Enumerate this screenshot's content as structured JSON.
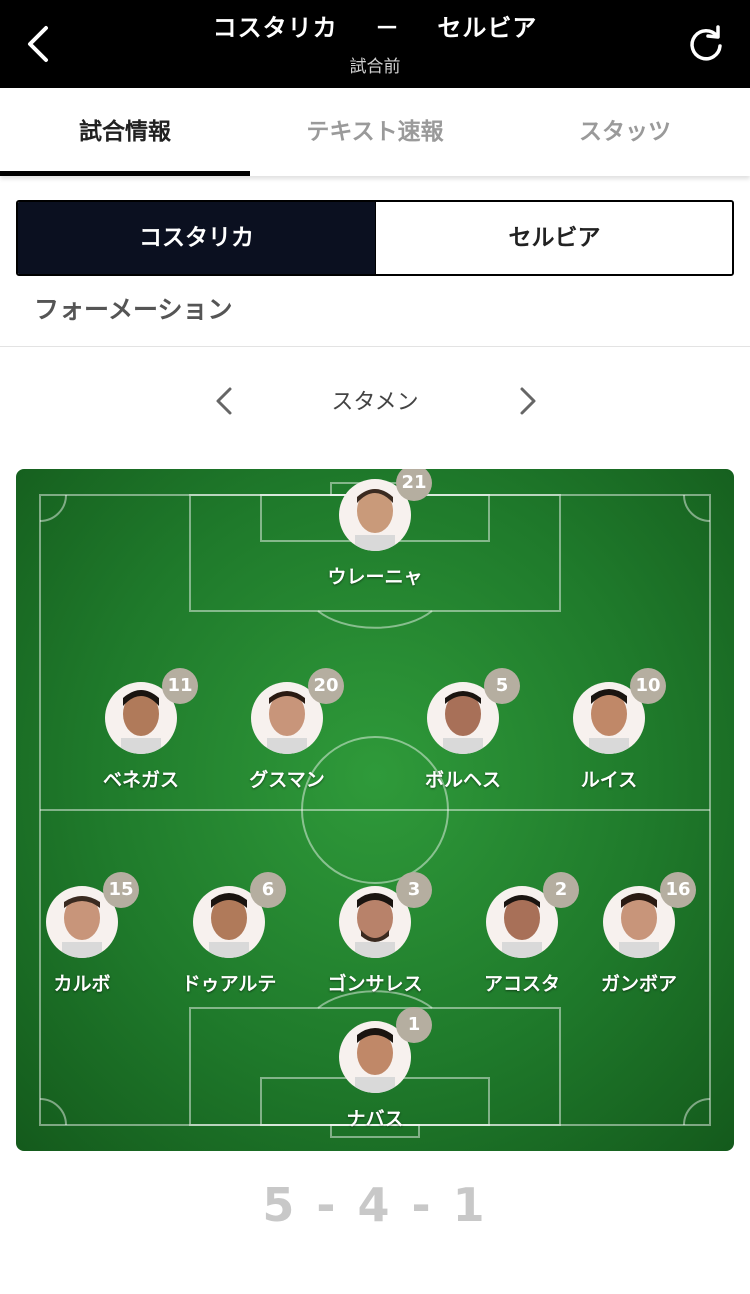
{
  "header": {
    "home": "コスタリカ",
    "separator": "－",
    "away": "セルビア",
    "status": "試合前",
    "back_icon": "chevron-left-icon",
    "refresh_icon": "refresh-icon"
  },
  "tabs": [
    {
      "label": "試合情報",
      "active": true
    },
    {
      "label": "テキスト速報",
      "active": false
    },
    {
      "label": "スタッツ",
      "active": false
    }
  ],
  "team_toggle": {
    "left": "コスタリカ",
    "right": "セルビア",
    "selected": "コスタリカ"
  },
  "section_title": "フォーメーション",
  "lineup": {
    "label": "スタメン",
    "prev_icon": "chevron-left-icon",
    "next_icon": "chevron-right-icon"
  },
  "players": [
    {
      "name": "ウレーニャ",
      "number": "21"
    },
    {
      "name": "ベネガス",
      "number": "11"
    },
    {
      "name": "グスマン",
      "number": "20"
    },
    {
      "name": "ボルヘス",
      "number": "5"
    },
    {
      "name": "ルイス",
      "number": "10"
    },
    {
      "name": "カルボ",
      "number": "15"
    },
    {
      "name": "ドゥアルテ",
      "number": "6"
    },
    {
      "name": "ゴンサレス",
      "number": "3"
    },
    {
      "name": "アコスタ",
      "number": "2"
    },
    {
      "name": "ガンボア",
      "number": "16"
    },
    {
      "name": "ナバス",
      "number": "1"
    }
  ],
  "formation": {
    "a": "5",
    "b": "4",
    "c": "1",
    "sep": "-"
  },
  "colors": {
    "header_bg": "#000000",
    "pitch_green": "#1f7a2b",
    "badge": "#b5aea0",
    "selected_team_bg": "#0b1020"
  }
}
